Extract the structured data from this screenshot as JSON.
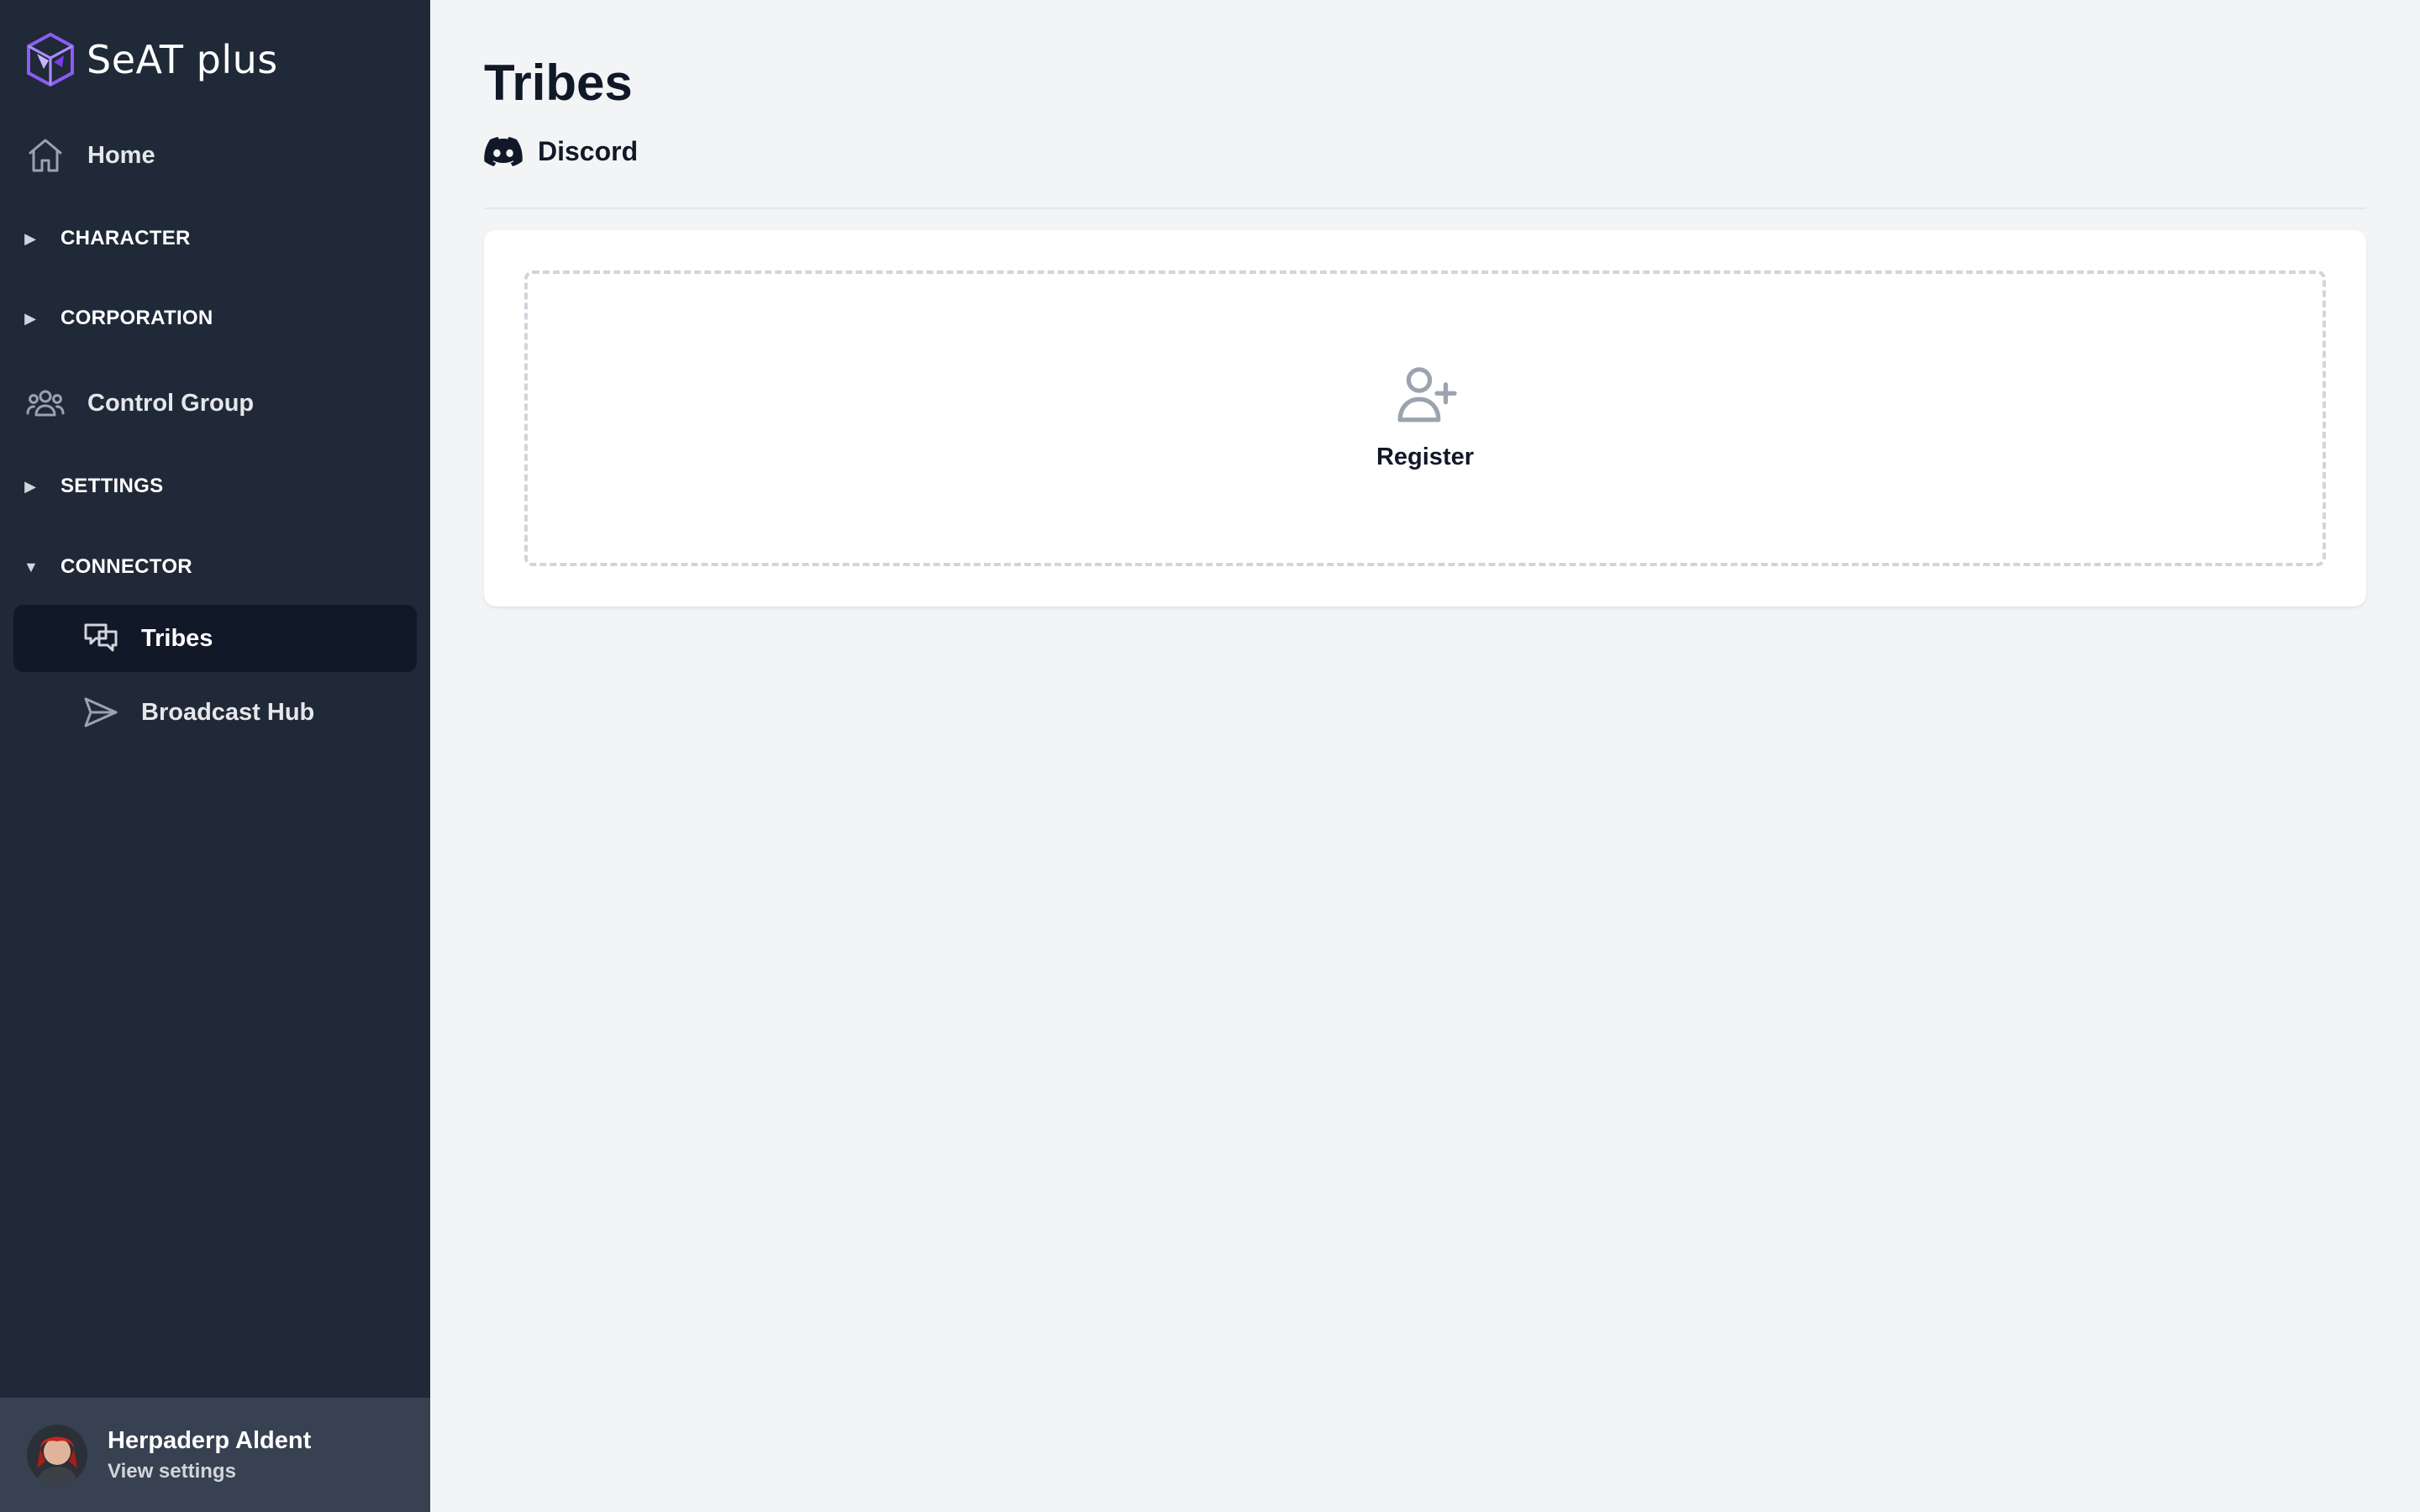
{
  "app": {
    "name": "SeAT plus"
  },
  "sidebar": {
    "home": {
      "label": "Home",
      "icon": "home-icon"
    },
    "sections": [
      {
        "label": "CHARACTER",
        "expanded": false
      },
      {
        "label": "CORPORATION",
        "expanded": false
      },
      {
        "label": "SETTINGS",
        "expanded": false
      },
      {
        "label": "CONNECTOR",
        "expanded": true
      }
    ],
    "control_group": {
      "label": "Control Group",
      "icon": "users-icon"
    },
    "connector_items": [
      {
        "label": "Tribes",
        "icon": "chat-bubbles-icon",
        "active": true
      },
      {
        "label": "Broadcast Hub",
        "icon": "paper-plane-icon",
        "active": false
      }
    ],
    "user": {
      "name": "Herpaderp Aldent",
      "link": "View settings"
    }
  },
  "main": {
    "title": "Tribes",
    "provider": {
      "label": "Discord",
      "icon": "discord-icon"
    },
    "register": {
      "label": "Register",
      "icon": "user-plus-icon"
    }
  },
  "colors": {
    "sidebar_bg": "#1f2937",
    "sidebar_active_bg": "#111827",
    "footer_bg": "#374151",
    "page_bg": "#f3f4f6",
    "brand_accent": "#8b5cf6"
  }
}
